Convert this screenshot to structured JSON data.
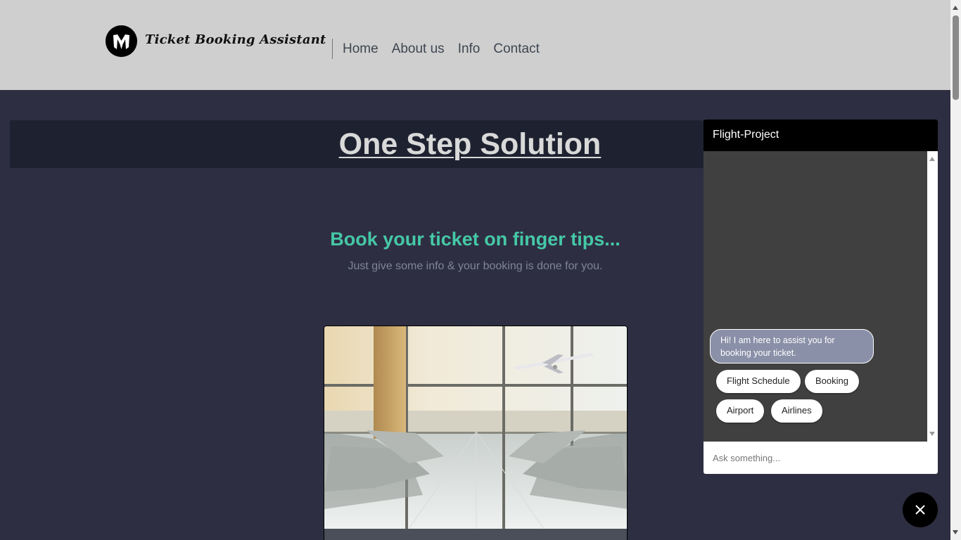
{
  "header": {
    "brand": "Ticket Booking Assistant",
    "nav": [
      "Home",
      "About us",
      "Info",
      "Contact"
    ]
  },
  "banner": {
    "title": "One Step Solution"
  },
  "hero": {
    "headline": "Book your ticket on finger tips...",
    "subline": "Just give some info & your booking is done for you."
  },
  "chat": {
    "title": "Flight-Project",
    "bot_message": "Hi! I am here to assist you for booking your ticket.",
    "chips": [
      "Flight Schedule",
      "Booking",
      "Airport",
      "Airlines"
    ],
    "input_placeholder": "Ask something..."
  },
  "colors": {
    "page_bg": "#2e2e42",
    "header_bg": "#cfcfcf",
    "accent": "#45c8a6",
    "chat_bg": "#404040",
    "bot_bubble": "#8a90a8"
  },
  "icons": {
    "logo": "mask-logo-icon",
    "close": "close-icon"
  }
}
